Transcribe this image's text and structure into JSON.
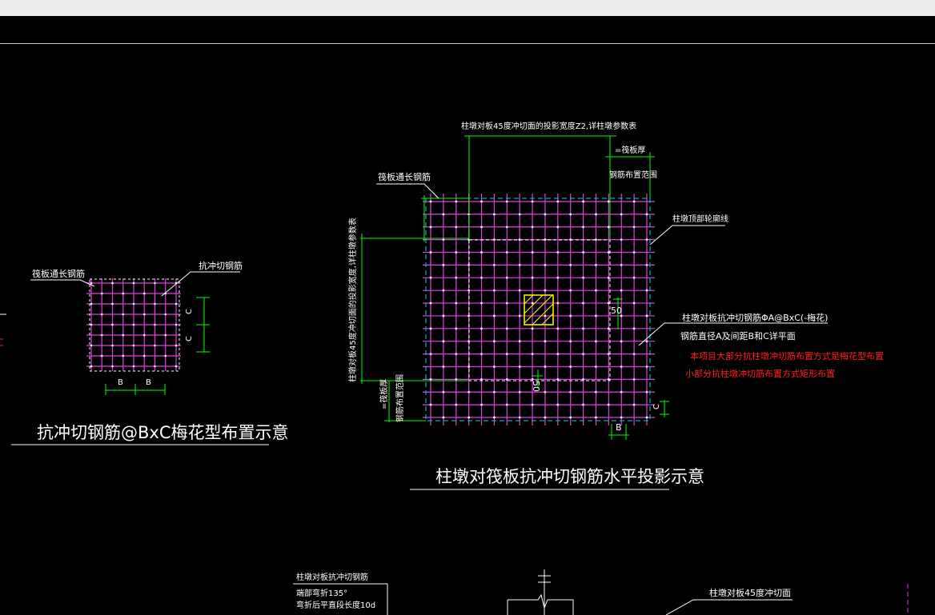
{
  "colors": {
    "background": "#000000",
    "rebar": "#e040e0",
    "dimension": "#00ff00",
    "column": "#ffff00",
    "dashed": "#00d8d8",
    "text": "#ffffff",
    "note": "#ff2020"
  },
  "left": {
    "label_raft_rebar": "筏板通长钢筋",
    "label_shear_rebar": "抗冲切钢筋",
    "dim_b1": "B",
    "dim_b2": "B",
    "dim_c1": "C",
    "dim_c2": "C",
    "title": "抗冲切钢筋@BxC梅花型布置示意"
  },
  "main": {
    "top_note": "柱墩对板45度冲切面的投影宽度Z2,详柱墩参数表",
    "raft_thickness": "=筏板厚",
    "rebar_range": "钢筋布置范围",
    "raft_rebar": "筏板通长钢筋",
    "pier_outline": "柱墩顶部轮廓线",
    "left_vertical_note": "柱墩对板45度冲切面的投影宽度,详柱墩参数表",
    "left_raft_thickness": "=筏板厚",
    "left_rebar_range": "钢筋布置范围",
    "dim_50_right": "50",
    "dim_50_bottom": "50",
    "dim_b": "B",
    "dim_c": "C",
    "spec": "柱墩对板抗冲切钢筋ΦA@BxC(-梅花)",
    "spec_detail": "钢筋直径A及间距B和C详平面",
    "note_red_1": "本项目大部分抗柱墩冲切筋布置方式是梅花型布置",
    "note_red_2": "小部分抗柱墩冲切筋布置方式矩形布置",
    "title": "柱墩对筏板抗冲切钢筋水平投影示意"
  },
  "bottom": {
    "note_title": "柱墩对板抗冲切钢筋",
    "note_line1": "端部弯折135°",
    "note_line2": "弯折后平直段长度10d",
    "punch_label": "柱墩对板45度冲切面"
  }
}
